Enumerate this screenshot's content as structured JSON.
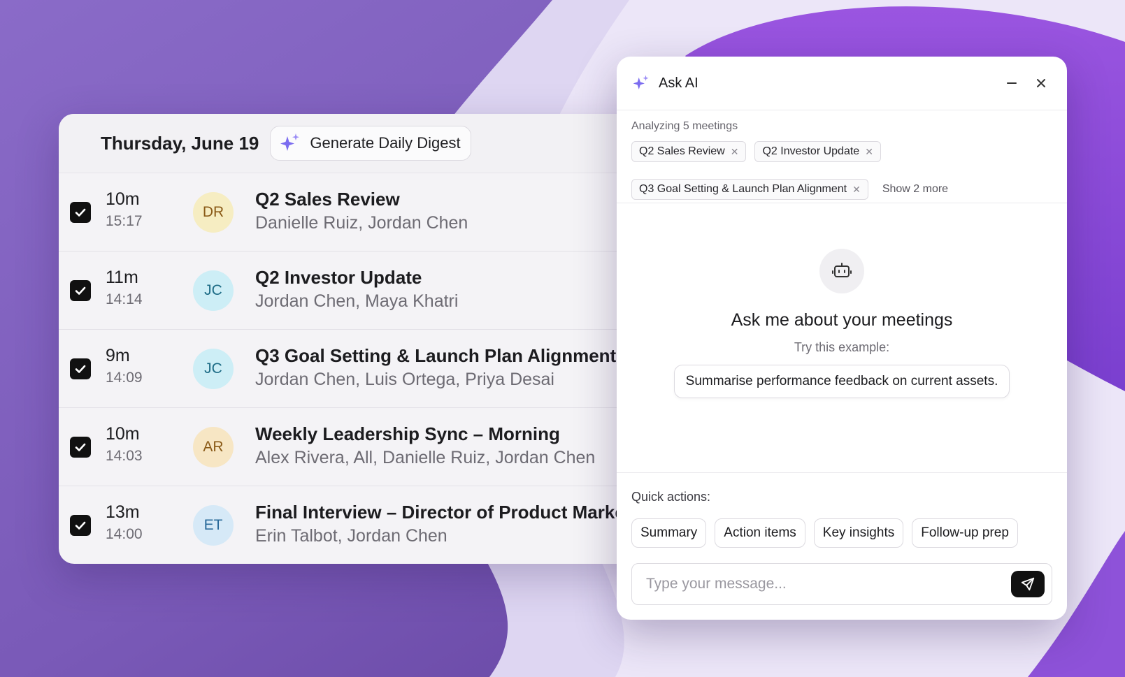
{
  "digest": {
    "date": "Thursday, June 19",
    "generate_label": "Generate Daily Digest"
  },
  "meetings": [
    {
      "duration": "10m",
      "time": "15:17",
      "initials": "DR",
      "title": "Q2 Sales Review",
      "attendees": "Danielle Ruiz, Jordan Chen",
      "avatar_bg": "#f6edc2",
      "avatar_fg": "#8a5a17",
      "checked": true
    },
    {
      "duration": "11m",
      "time": "14:14",
      "initials": "JC",
      "title": "Q2 Investor Update",
      "attendees": "Jordan Chen, Maya Khatri",
      "avatar_bg": "#cdeef6",
      "avatar_fg": "#1d6c86",
      "checked": true
    },
    {
      "duration": "9m",
      "time": "14:09",
      "initials": "JC",
      "title": "Q3 Goal Setting & Launch Plan Alignment",
      "attendees": "Jordan Chen, Luis Ortega, Priya Desai",
      "avatar_bg": "#cdeef6",
      "avatar_fg": "#1d6c86",
      "checked": true
    },
    {
      "duration": "10m",
      "time": "14:03",
      "initials": "AR",
      "title": "Weekly Leadership Sync – Morning",
      "attendees": "Alex Rivera, All, Danielle Ruiz, Jordan Chen",
      "avatar_bg": "#f7e6c4",
      "avatar_fg": "#8a5a17",
      "checked": true
    },
    {
      "duration": "13m",
      "time": "14:00",
      "initials": "ET",
      "title": "Final Interview – Director of Product Marketing",
      "attendees": "Erin Talbot, Jordan Chen",
      "avatar_bg": "#d6e9f7",
      "avatar_fg": "#2a6a9a",
      "checked": true
    }
  ],
  "ask_ai": {
    "title": "Ask AI",
    "analyzing": "Analyzing 5 meetings",
    "chips": [
      "Q2 Sales Review",
      "Q2 Investor Update",
      "Q3 Goal Setting & Launch Plan Alignment"
    ],
    "show_more": "Show 2 more",
    "heading": "Ask me about your meetings",
    "try_label": "Try this example:",
    "example": "Summarise performance feedback on current assets.",
    "quick_label": "Quick actions:",
    "quick_actions": [
      "Summary",
      "Action items",
      "Key insights",
      "Follow-up prep"
    ],
    "input_placeholder": "Type your message..."
  },
  "colors": {
    "accent_sparkle": "#7b6cf0",
    "bg_purple": "#7d5bbf"
  }
}
